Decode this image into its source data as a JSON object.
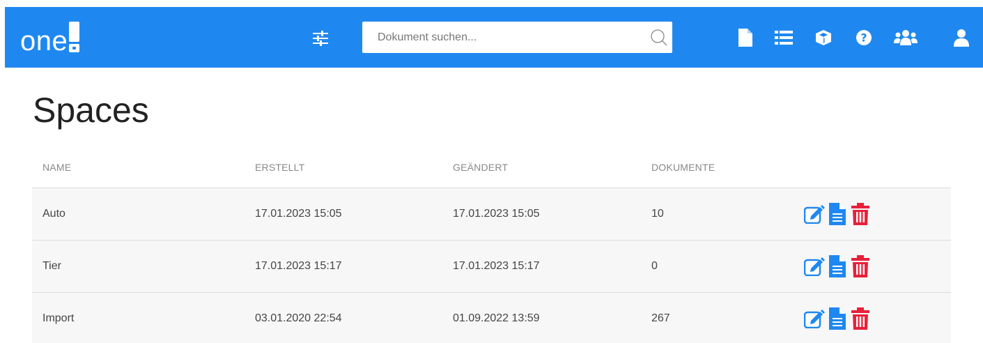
{
  "app": {
    "logo_text": "one",
    "search": {
      "placeholder": "Dokument suchen...",
      "value": ""
    },
    "colors": {
      "brand": "#1f88f0",
      "edit": "#1f88f0",
      "delete": "#e8203a"
    },
    "nav_icons": [
      "document-icon",
      "list-icon",
      "cube-icon",
      "help-icon",
      "users-icon",
      "user-icon"
    ]
  },
  "page": {
    "title": "Spaces"
  },
  "table": {
    "headers": {
      "name": "NAME",
      "created": "ERSTELLT",
      "changed": "GEÄNDERT",
      "docs": "DOKUMENTE"
    },
    "rows": [
      {
        "name": "Auto",
        "created": "17.01.2023 15:05",
        "changed": "17.01.2023 15:05",
        "docs": "10"
      },
      {
        "name": "Tier",
        "created": "17.01.2023 15:17",
        "changed": "17.01.2023 15:17",
        "docs": "0"
      },
      {
        "name": "Import",
        "created": "03.01.2020 22:54",
        "changed": "01.09.2022 13:59",
        "docs": "267"
      }
    ],
    "row_actions": [
      "edit-icon",
      "document-icon",
      "trash-icon"
    ]
  }
}
